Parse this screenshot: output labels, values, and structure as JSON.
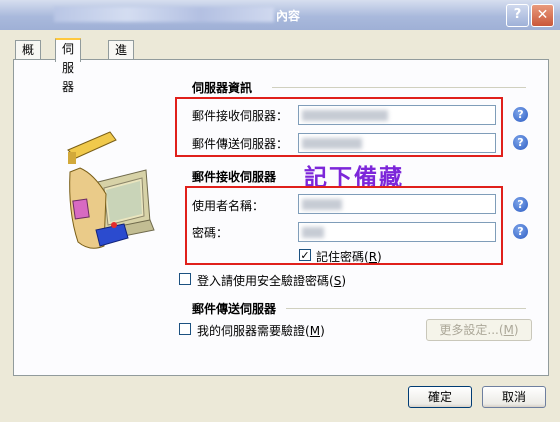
{
  "window": {
    "title_suffix": "內容",
    "help": "?",
    "close": "✕"
  },
  "tabs": [
    {
      "label": "概述"
    },
    {
      "label": "伺服器"
    },
    {
      "label": "進階"
    }
  ],
  "server_info": {
    "title": "伺服器資訊",
    "incoming_label": "郵件接收伺服器：",
    "outgoing_label": "郵件傳送伺服器："
  },
  "incoming_server": {
    "title": "郵件接收伺服器",
    "username_label": "使用者名稱：",
    "password_label": "密碼：",
    "remember_password": {
      "label": "記住密碼",
      "key": "R",
      "checked": true
    },
    "secure_auth": {
      "label": "登入請使用安全驗證密碼",
      "key": "S",
      "checked": false
    }
  },
  "annotation": {
    "text": "記下備藏",
    "color": "#7c26d9"
  },
  "outgoing_server": {
    "title": "郵件傳送伺服器",
    "requires_auth": {
      "label": "我的伺服器需要驗證",
      "key": "M",
      "checked": false
    },
    "settings_button": "更多設定...",
    "settings_key": "M"
  },
  "buttons": {
    "ok": "確定",
    "cancel": "取消"
  },
  "help_icon": "?",
  "colors": {
    "highlight": "#e0201b",
    "title_bar": "#a9b9dc"
  }
}
